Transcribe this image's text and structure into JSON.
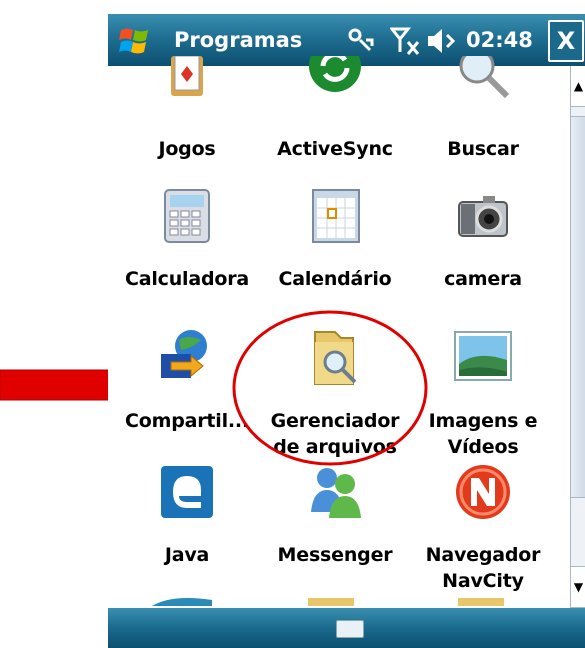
{
  "titlebar": {
    "title": "Programas",
    "time": "02:48",
    "close_label": "X"
  },
  "apps": [
    {
      "label": "Jogos",
      "icon": "games-icon"
    },
    {
      "label": "ActiveSync",
      "icon": "activesync-icon"
    },
    {
      "label": "Buscar",
      "icon": "search-icon"
    },
    {
      "label": "Calculadora",
      "icon": "calculator-icon"
    },
    {
      "label": "Calendário",
      "icon": "calendar-icon"
    },
    {
      "label": "camera",
      "icon": "camera-icon"
    },
    {
      "label": "Compartil...",
      "icon": "sharing-icon"
    },
    {
      "label": "Gerenciador de arquivos",
      "label_line1": "Gerenciador",
      "label_line2": "de arquivos",
      "icon": "file-manager-icon"
    },
    {
      "label": "Imagens e Vídeos",
      "label_line1": "Imagens e",
      "label_line2": "Vídeos",
      "icon": "pictures-videos-icon"
    },
    {
      "label": "Java",
      "icon": "java-icon"
    },
    {
      "label": "Messenger",
      "icon": "messenger-icon"
    },
    {
      "label": "Navegador NavCity",
      "label_line1": "Navegador",
      "label_line2": "NavCity",
      "icon": "navcity-icon"
    }
  ],
  "colors": {
    "titlebar": "#1f6f92",
    "annotation_red": "#e00000"
  }
}
